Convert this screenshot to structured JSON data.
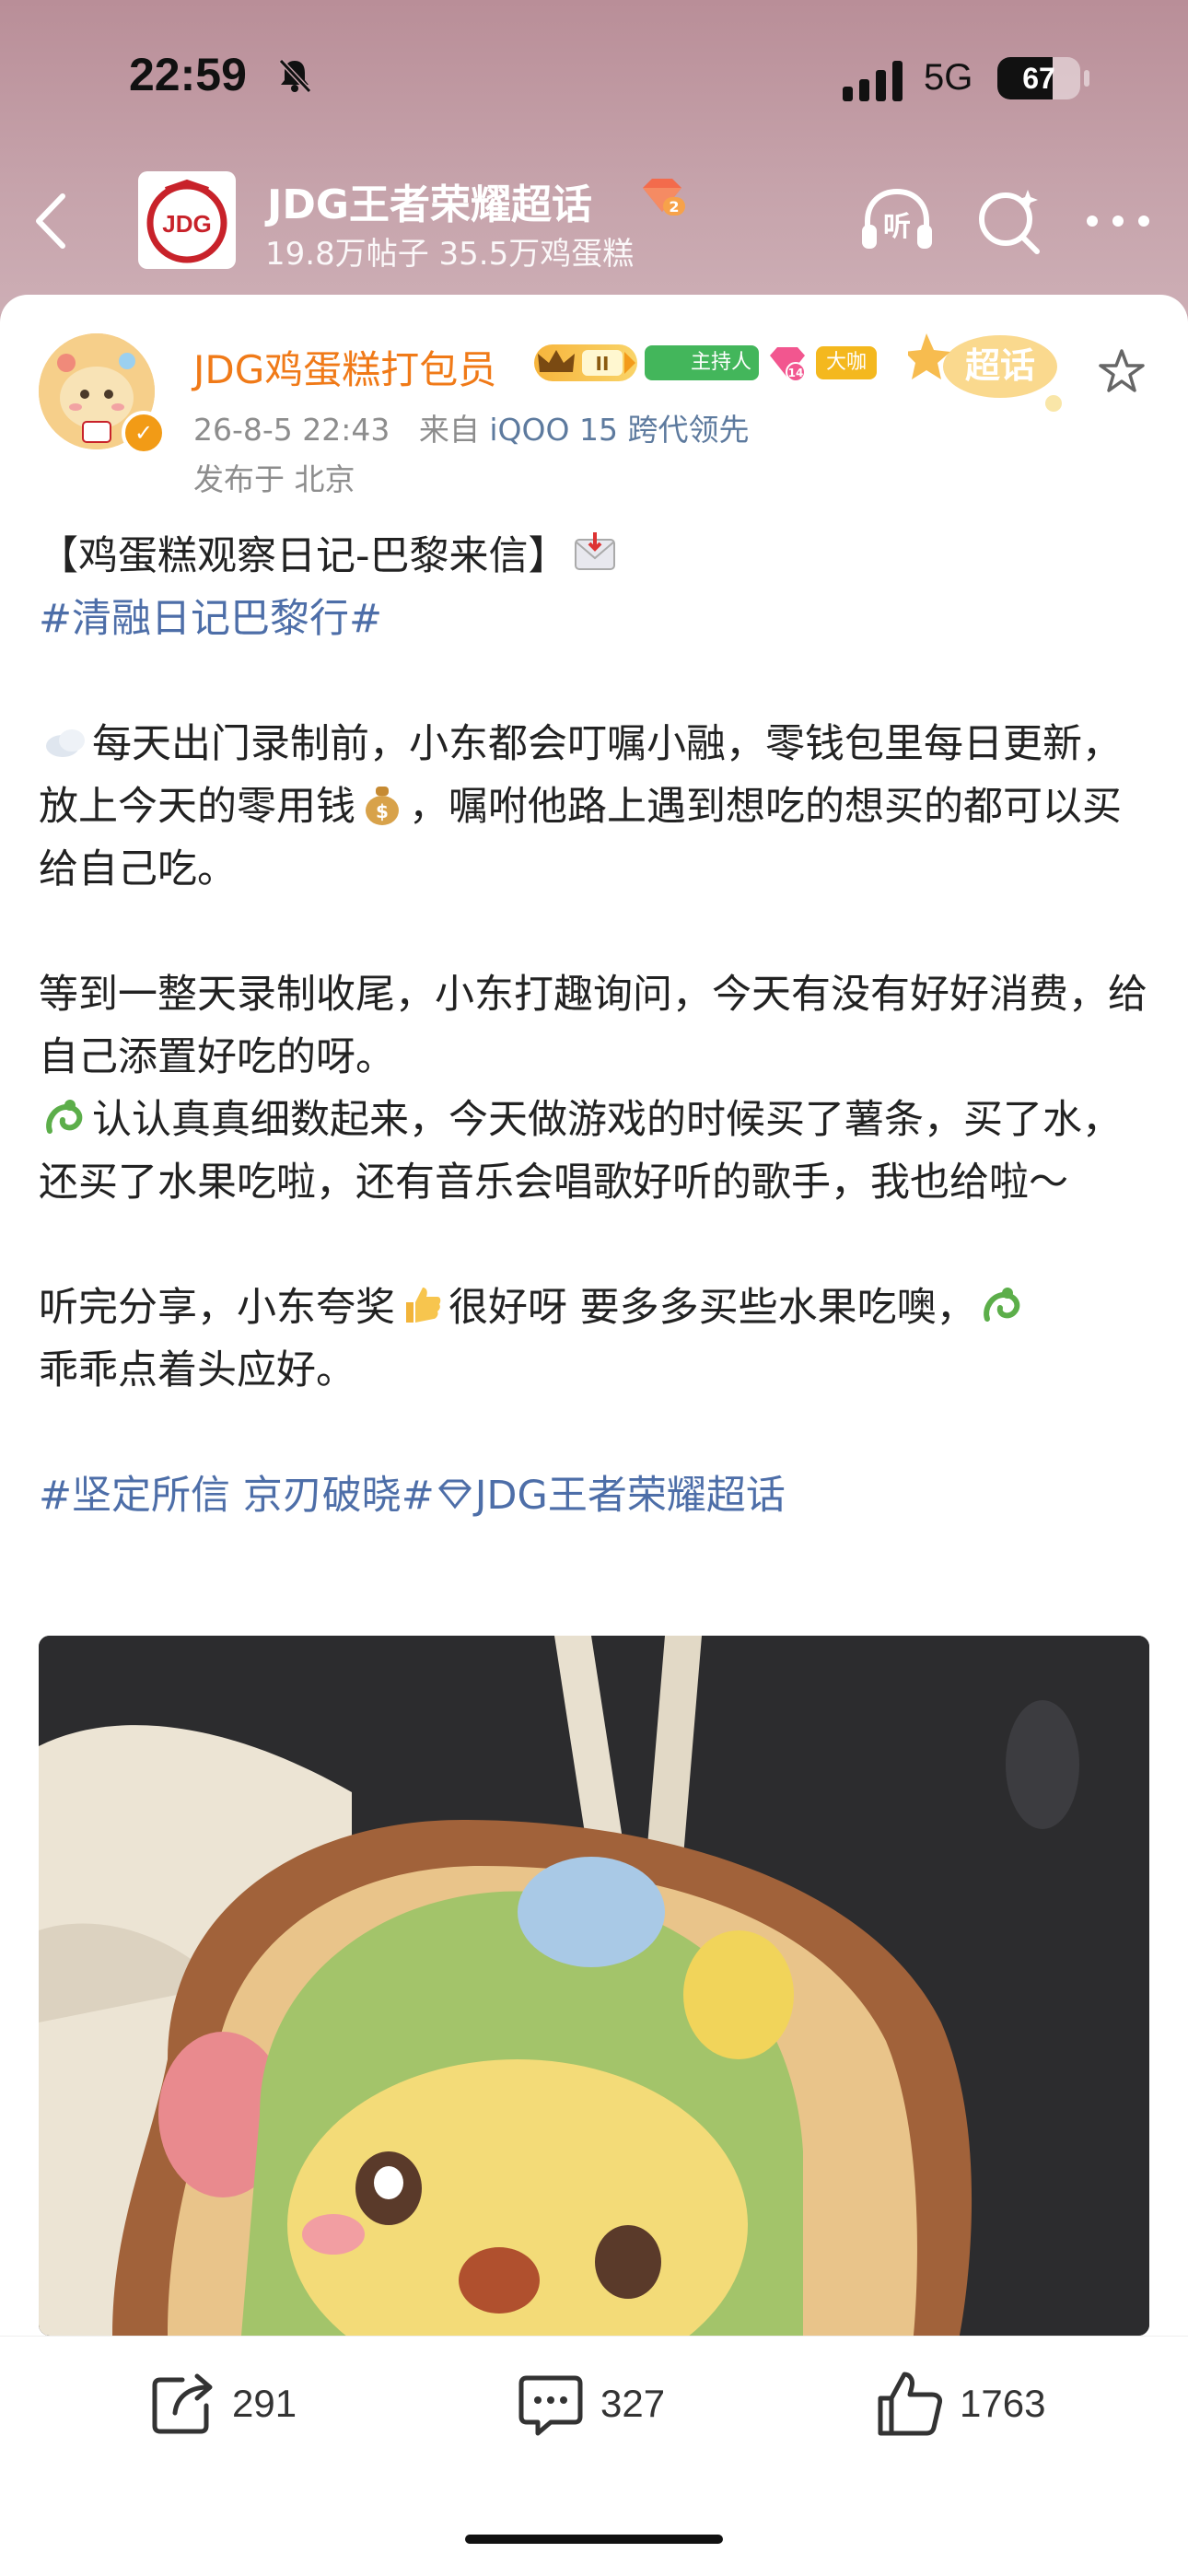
{
  "status_bar": {
    "time": "22:59",
    "network": "5G",
    "battery_level": 67,
    "battery_text": "67",
    "icons": [
      "bell-off-icon",
      "signal-icon",
      "battery-icon"
    ]
  },
  "header": {
    "title": "JDG王者荣耀超话",
    "stats": "19.8万帖子 35.5万鸡蛋糕",
    "logo_text": "JDG",
    "level_badge": "2",
    "icons": [
      "back-icon",
      "listen-icon",
      "search-icon",
      "more-icon"
    ],
    "listen_label": "听"
  },
  "post": {
    "author": "JDG鸡蛋糕打包员",
    "badges": {
      "crown_level": "II",
      "host_label": "主持人",
      "gem_level": "14",
      "big_label": "大咖"
    },
    "chaohua_badge": "超话",
    "time": "26-8-5 22:43",
    "source_prefix": "来自",
    "device": "iQOO 15 跨代领先",
    "location": "发布于 北京",
    "title": "【鸡蛋糕观察日记-巴黎来信】",
    "hashtag1": "#清融日记巴黎行#",
    "para1": "每天出门录制前，小东都会叮嘱小融，零钱包里每日更新，放上今天的零用钱",
    "para1b": "，嘱咐他路上遇到想吃的想买的都可以买给自己吃。",
    "para2": "等到一整天录制收尾，小东打趣询问，今天有没有好好消费，给自己添置好吃的呀。",
    "para3": "认认真真细数起来，今天做游戏的时候买了薯条，买了水，还买了水果吃啦，还有音乐会唱歌好听的歌手，我也给啦～",
    "para4a": "听完分享，小东夸奖",
    "para4b": "很好呀 要多多买些水果吃噢，",
    "para4c": "乖乖点着头应好。",
    "hashtag2": "#坚定所信 京刃破晓#",
    "topic_link": "JDG王者荣耀超话"
  },
  "actions": {
    "share_count": "291",
    "comment_count": "327",
    "like_count": "1763"
  },
  "colors": {
    "accent_orange": "#f07a18",
    "link_blue": "#4d6ea8",
    "header_bg": "#c19aa3",
    "logo_red": "#c8222a"
  }
}
